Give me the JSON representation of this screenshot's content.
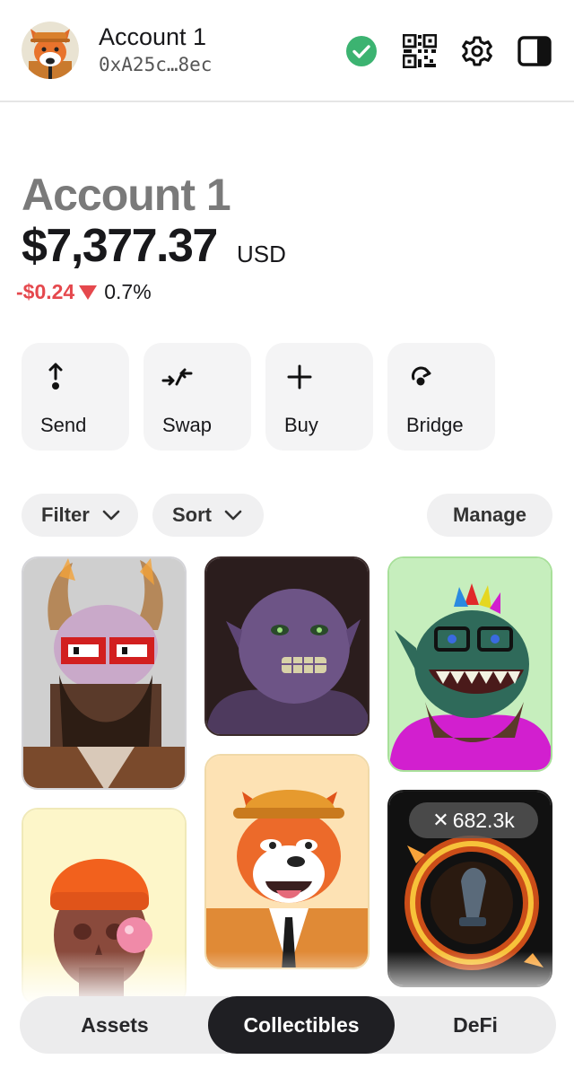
{
  "header": {
    "account_name": "Account 1",
    "address": "0xA25c…8ec",
    "icons": [
      "connected-check-icon",
      "qr-code-icon",
      "gear-icon",
      "sidebar-panel-icon"
    ],
    "status_color": "#3cb371"
  },
  "portfolio": {
    "title": "Account 1",
    "balance": "$7,377.37",
    "currency": "USD",
    "change_amount": "-$0.24",
    "change_direction": "down",
    "change_percent": "0.7%",
    "negative_color": "#e5484d"
  },
  "actions": [
    {
      "label": "Send",
      "icon": "send-arrow-icon"
    },
    {
      "label": "Swap",
      "icon": "swap-arrows-icon"
    },
    {
      "label": "Buy",
      "icon": "plus-icon"
    },
    {
      "label": "Bridge",
      "icon": "bridge-icon"
    }
  ],
  "controls": {
    "filter_label": "Filter",
    "sort_label": "Sort",
    "manage_label": "Manage"
  },
  "collectibles": {
    "items": [
      {
        "name": "horned-skull-ape"
      },
      {
        "name": "purple-ogre"
      },
      {
        "name": "green-goblin-ape"
      },
      {
        "name": "orange-beanie-skull"
      },
      {
        "name": "shiba-in-hardhat"
      },
      {
        "name": "flaming-ring-trophy",
        "badge": "682.3k"
      }
    ]
  },
  "tabs": {
    "items": [
      "Assets",
      "Collectibles",
      "DeFi"
    ],
    "active": "Collectibles"
  }
}
